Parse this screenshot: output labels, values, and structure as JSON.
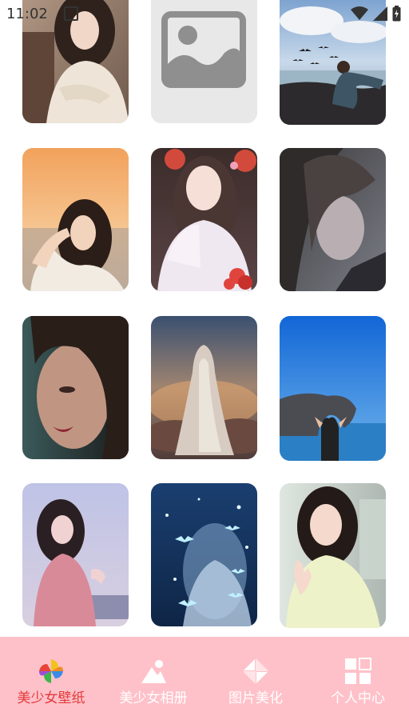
{
  "status_bar": {
    "time": "11:02"
  },
  "gallery": {
    "photos": [
      {
        "name": "girl-beige-sweater"
      },
      {
        "name": "image-placeholder"
      },
      {
        "name": "girl-seaside-birds"
      },
      {
        "name": "girl-sunset-beach"
      },
      {
        "name": "anime-hanfu-girl"
      },
      {
        "name": "anime-dark-portrait"
      },
      {
        "name": "girl-moody-closeup"
      },
      {
        "name": "cloaked-figure-clouds"
      },
      {
        "name": "girl-sea-arch"
      },
      {
        "name": "girl-pink-dress"
      },
      {
        "name": "anime-blue-birds"
      },
      {
        "name": "girl-yellow-shirt"
      }
    ]
  },
  "bottom_nav": {
    "active_color": "#e23b3b",
    "background": "#ffc1c9",
    "items": [
      {
        "label": "美少女壁纸",
        "icon": "pinwheel-icon"
      },
      {
        "label": "美少女相册",
        "icon": "mountain-icon"
      },
      {
        "label": "图片美化",
        "icon": "diamond-icon"
      },
      {
        "label": "个人中心",
        "icon": "grid-icon"
      }
    ]
  }
}
